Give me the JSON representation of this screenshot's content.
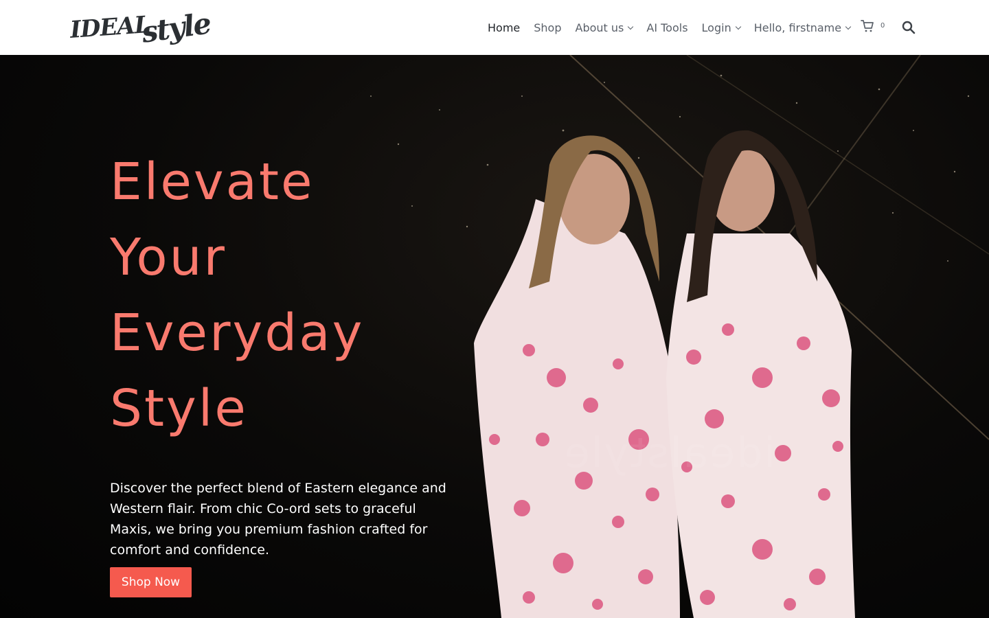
{
  "brand": {
    "logo_word1": "IDEAL",
    "logo_word2": "style",
    "logo_color": "#2b2f33"
  },
  "nav": {
    "items": [
      {
        "label": "Home",
        "active": true,
        "dropdown": false
      },
      {
        "label": "Shop",
        "active": false,
        "dropdown": false
      },
      {
        "label": "About us",
        "active": false,
        "dropdown": true
      },
      {
        "label": "AI Tools",
        "active": false,
        "dropdown": false
      },
      {
        "label": "Login",
        "active": false,
        "dropdown": true
      },
      {
        "label": "Hello, firstname",
        "active": false,
        "dropdown": true
      }
    ],
    "cart_count": "0",
    "cart_icon": "cart-icon",
    "search_icon": "search-icon"
  },
  "hero": {
    "title_lines": [
      "Elevate",
      "Your",
      "Everyday",
      "Style"
    ],
    "description": "Discover the perfect blend of Eastern elegance and Western flair. From chic Co-ord sets to graceful Maxis, we bring you premium fashion crafted for comfort and confidence.",
    "cta_label": "Shop Now",
    "title_color": "#f97a6e",
    "cta_color": "#f55a4e",
    "image_subject": "two models in pink polka-dot dresses",
    "watermark": "idealstyle"
  }
}
